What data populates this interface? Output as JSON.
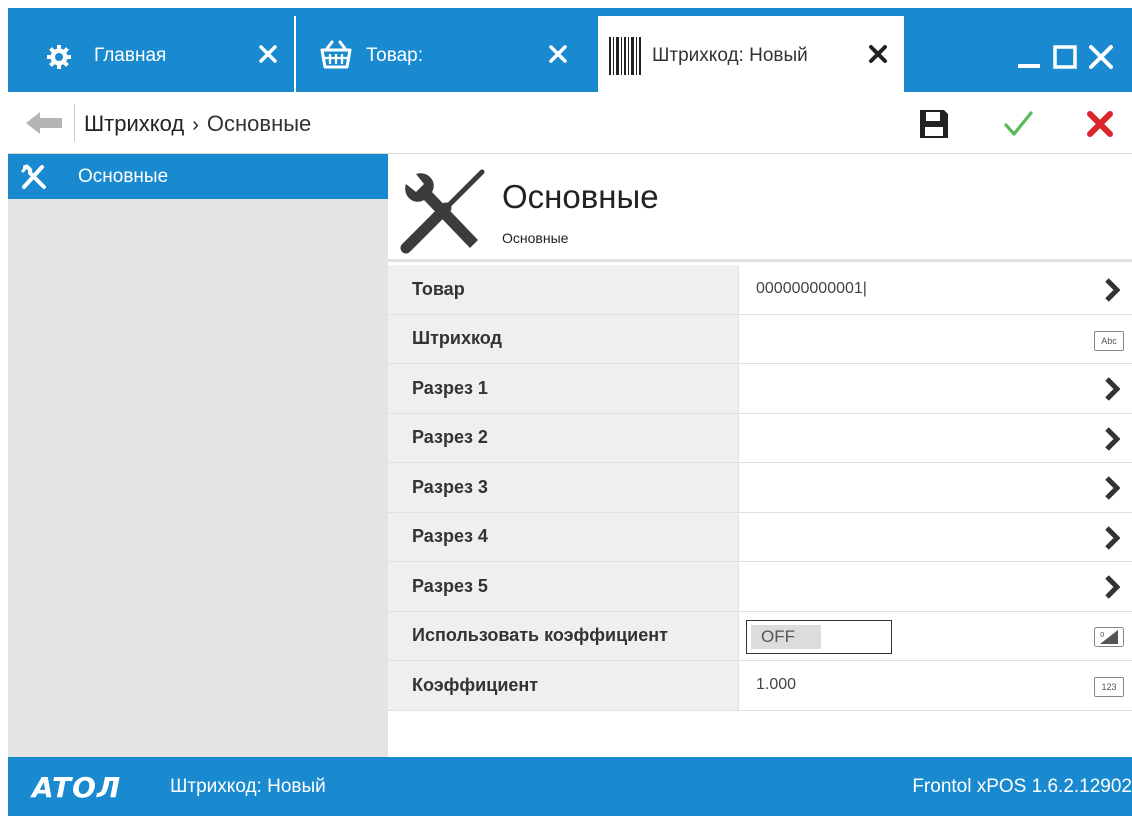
{
  "tabs": [
    {
      "label": "Главная",
      "icon": "gear-icon",
      "active": false
    },
    {
      "label": "Товар:",
      "icon": "basket-icon",
      "active": false
    },
    {
      "label": "Штрихкод: Новый",
      "icon": "barcode-icon",
      "active": true
    }
  ],
  "window_controls": [
    "minimize",
    "maximize",
    "close"
  ],
  "toolbar": {
    "breadcrumb": [
      "Штрихкод",
      "Основные"
    ],
    "breadcrumb_separator": "›",
    "buttons": [
      "save",
      "apply",
      "cancel"
    ]
  },
  "sidebar": {
    "items": [
      {
        "label": "Основные",
        "icon": "tools-icon",
        "selected": true
      }
    ]
  },
  "section": {
    "title": "Основные",
    "subtitle": "Основные",
    "icon": "tools-icon"
  },
  "properties": [
    {
      "label": "Товар",
      "value": "000000000001|",
      "type": "chevron"
    },
    {
      "label": "Штрихкод",
      "value": "",
      "type": "text",
      "type_label": "Abc"
    },
    {
      "label": "Разрез 1",
      "value": "",
      "type": "chevron"
    },
    {
      "label": "Разрез 2",
      "value": "",
      "type": "chevron"
    },
    {
      "label": "Разрез 3",
      "value": "",
      "type": "chevron"
    },
    {
      "label": "Разрез 4",
      "value": "",
      "type": "chevron"
    },
    {
      "label": "Разрез 5",
      "value": "",
      "type": "chevron"
    },
    {
      "label": "Использовать коэффициент",
      "value": "OFF",
      "type": "toggle",
      "type_label": "0/1"
    },
    {
      "label": "Коэффициент",
      "value": "1.000",
      "type": "number",
      "type_label": "123"
    }
  ],
  "statusbar": {
    "logo": "ATOЛ",
    "document": "Штрихкод: Новый",
    "version": "Frontol xPOS 1.6.2.12902"
  },
  "colors": {
    "accent": "#1a8ad0",
    "sidebar_bg": "#e4e4e4",
    "label_bg": "#efefef",
    "apply_green": "#5cb85c",
    "cancel_red": "#d9252b"
  }
}
